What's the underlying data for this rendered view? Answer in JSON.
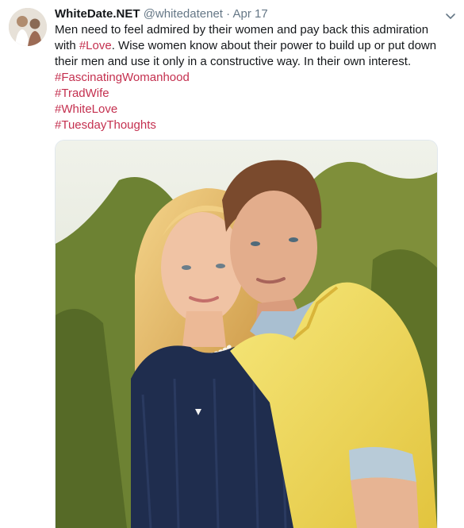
{
  "tweet": {
    "author_name": "WhiteDate.NET",
    "handle": "@whitedatenet",
    "separator": "·",
    "date": "Apr 17",
    "text_before": "Men need to feel admired by their women and pay back this admiration with ",
    "inline_hashtag": "#Love",
    "text_after": ". Wise women know about their power to build up or put down their men and use it only in a constructive way. In their own interest.",
    "hashtags": [
      "#FascinatingWomanhood",
      "#TradWife",
      "#WhiteLove",
      "#TuesdayThoughts"
    ]
  },
  "icons": {
    "menu": "chevron-down-icon",
    "avatar": "profile-avatar"
  },
  "colors": {
    "hashtag": "#c4304f",
    "muted": "#657786",
    "text": "#14171a"
  }
}
